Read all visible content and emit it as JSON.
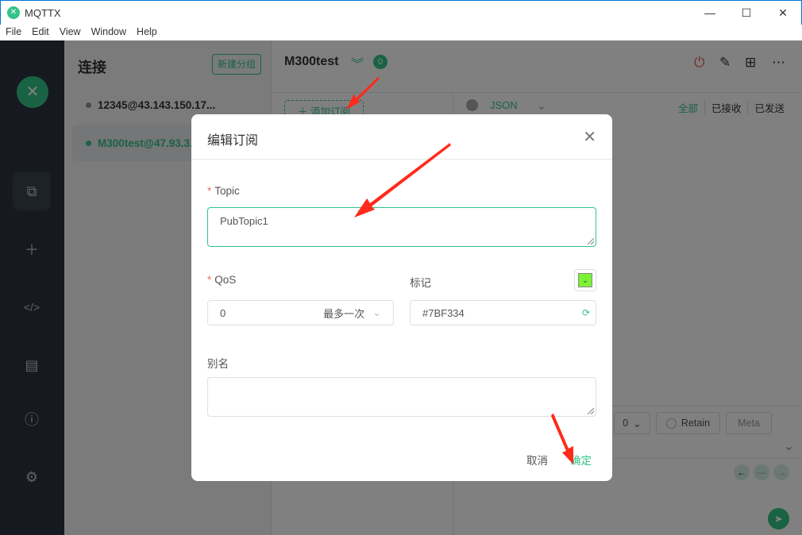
{
  "window": {
    "title": "MQTTX",
    "minimize": "—",
    "maximize": "☐",
    "close": "✕"
  },
  "menu": [
    "File",
    "Edit",
    "View",
    "Window",
    "Help"
  ],
  "connections": {
    "title": "连接",
    "new_group": "新建分组",
    "items": [
      {
        "label": "12345@43.143.150.17...",
        "status_color": "#909399"
      },
      {
        "label": "M300test@47.93.3...",
        "status_color": "#34c388"
      }
    ]
  },
  "main": {
    "name": "M300test",
    "badge": "0",
    "add_subscription": "添加订阅",
    "format": "JSON",
    "filters": [
      "全部",
      "已接收",
      "已发送"
    ],
    "qos": "0",
    "retain": "Retain",
    "meta": "Meta"
  },
  "dialog": {
    "title": "编辑订阅",
    "topic_label": "Topic",
    "topic_value": "PubTopic1",
    "qos_label": "QoS",
    "qos_value": "0",
    "qos_desc": "最多一次",
    "mark_label": "标记",
    "mark_value": "#7BF334",
    "alias_label": "别名",
    "alias_value": "",
    "cancel": "取消",
    "ok": "确定"
  },
  "colors": {
    "accent": "#34c388",
    "mark": "#7BF334",
    "arrow": "#ff2a1a"
  }
}
